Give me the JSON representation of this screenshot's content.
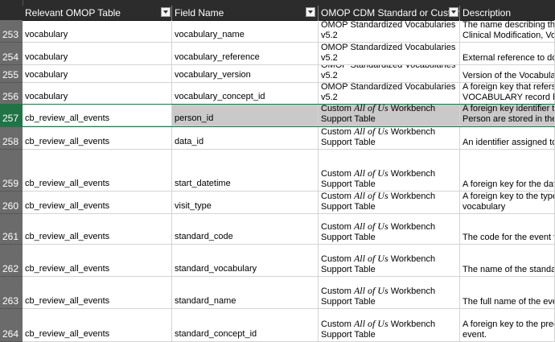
{
  "columns": [
    {
      "label": "Relevant OMOP Table"
    },
    {
      "label": "Field Name"
    },
    {
      "label": "OMOP CDM Standard or Custom"
    },
    {
      "label": "Description"
    }
  ],
  "rows": [
    {
      "num": "253",
      "table": "vocabulary",
      "field": "vocabulary_name",
      "std_line1": "OMOP Standardized Vocabularies",
      "std_line2": "v5.2",
      "desc_line1": "The name describing the",
      "desc_line2": "Clinical Modification, Volu"
    },
    {
      "num": "254",
      "table": "vocabulary",
      "field": "vocabulary_reference",
      "std_line1": "OMOP Standardized Vocabularies",
      "std_line2": "v5.2",
      "desc_line1": "",
      "desc_line2": "External reference to docu"
    },
    {
      "num": "255",
      "table": "vocabulary",
      "field": "vocabulary_version",
      "std_line1": "OMOP Standardized Vocabularies",
      "std_line2": "v5.2",
      "desc_line1": "",
      "desc_line2": "Version of the Vocabulary"
    },
    {
      "num": "256",
      "table": "vocabulary",
      "field": "vocabulary_concept_id",
      "std_line1": "OMOP Standardized Vocabularies",
      "std_line2": "v5.2",
      "desc_line1": "A foreign key that refers to",
      "desc_line2": "VOCABULARY record be"
    },
    {
      "num": "257",
      "table": "cb_review_all_events",
      "field": "person_id",
      "std_pre": "Custom ",
      "std_ital": "All of Us",
      "std_post": " Workbench",
      "std_line2": "Support Table",
      "desc_line1": "A foreign key identifier to t",
      "desc_line2": "Person are stored in the P"
    },
    {
      "num": "258",
      "table": "cb_review_all_events",
      "field": "data_id",
      "std_pre": "Custom ",
      "std_ital": "All of Us",
      "std_post": " Workbench",
      "std_line2": "Support Table",
      "desc_line1": "",
      "desc_line2": "An identifier assigned to t"
    },
    {
      "num": "259",
      "table": "cb_review_all_events",
      "field": "start_datetime",
      "std_pre": "Custom ",
      "std_ital": "All of Us",
      "std_post": " Workbench",
      "std_line2": "Support Table",
      "desc_line1": "",
      "desc_line2": "A foreign key for the date"
    },
    {
      "num": "260",
      "table": "cb_review_all_events",
      "field": "visit_type",
      "std_pre": "Custom ",
      "std_ital": "All of Us",
      "std_post": " Workbench",
      "std_line2": "Support Table",
      "desc_line1": "A foreign key to the type o",
      "desc_line2": "vocabulary"
    },
    {
      "num": "261",
      "table": "cb_review_all_events",
      "field": "standard_code",
      "std_pre": "Custom ",
      "std_ital": "All of Us",
      "std_post": " Workbench",
      "std_line2": "Support Table",
      "desc_line1": "",
      "desc_line2": "The code for the event fro"
    },
    {
      "num": "262",
      "table": "cb_review_all_events",
      "field": "standard_vocabulary",
      "std_pre": "Custom ",
      "std_ital": "All of Us",
      "std_post": " Workbench",
      "std_line2": "Support Table",
      "desc_line1": "",
      "desc_line2": "The name of the standard"
    },
    {
      "num": "263",
      "table": "cb_review_all_events",
      "field": "standard_name",
      "std_pre": "Custom ",
      "std_ital": "All of Us",
      "std_post": " Workbench",
      "std_line2": "Support Table",
      "desc_line1": "",
      "desc_line2": "The full name of the event"
    },
    {
      "num": "264",
      "table": "cb_review_all_events",
      "field": "standard_concept_id",
      "std_pre": "Custom ",
      "std_ital": "All of Us",
      "std_post": " Workbench",
      "std_line2": "Support Table",
      "desc_line1": "A foreign key to the prede",
      "desc_line2": "event."
    }
  ],
  "selected_row": "257",
  "colors": {
    "header_bg": "#2c2c2c",
    "rownum_bg": "#6b6b6b",
    "selected_accent": "#217346",
    "selected_fill": "#c9c9c9"
  }
}
